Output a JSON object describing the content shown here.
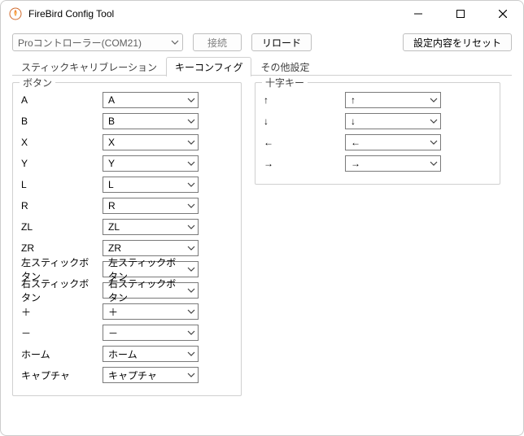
{
  "window": {
    "title": "FireBird Config Tool"
  },
  "toolbar": {
    "device_selected": "Proコントローラー(COM21)",
    "connect_label": "接続",
    "reload_label": "リロード",
    "reset_label": "設定内容をリセット"
  },
  "tabs": {
    "stick": "スティックキャリブレーション",
    "key": "キーコンフィグ",
    "other": "その他設定",
    "active": "key"
  },
  "groups": {
    "buttons_legend": "ボタン",
    "dpad_legend": "十字キー"
  },
  "buttons": [
    {
      "label": "A",
      "value": "A"
    },
    {
      "label": "B",
      "value": "B"
    },
    {
      "label": "X",
      "value": "X"
    },
    {
      "label": "Y",
      "value": "Y"
    },
    {
      "label": "L",
      "value": "L"
    },
    {
      "label": "R",
      "value": "R"
    },
    {
      "label": "ZL",
      "value": "ZL"
    },
    {
      "label": "ZR",
      "value": "ZR"
    },
    {
      "label": "左スティックボタン",
      "value": "左スティックボタン"
    },
    {
      "label": "右スティックボタン",
      "value": "右スティックボタン"
    },
    {
      "label": "＋",
      "value": "＋"
    },
    {
      "label": "－",
      "value": "－"
    },
    {
      "label": "ホーム",
      "value": "ホーム"
    },
    {
      "label": "キャプチャ",
      "value": "キャプチャ"
    }
  ],
  "dpad": [
    {
      "label": "↑",
      "value": "↑"
    },
    {
      "label": "↓",
      "value": "↓"
    },
    {
      "label": "←",
      "value": "←"
    },
    {
      "label": "→",
      "value": "→"
    }
  ]
}
